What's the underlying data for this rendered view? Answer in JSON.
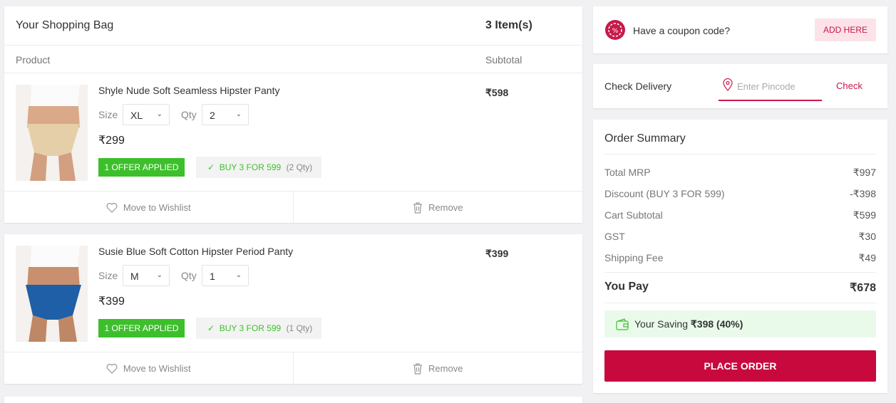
{
  "bag": {
    "title": "Your Shopping Bag",
    "count": "3 Item(s)",
    "col_product": "Product",
    "col_subtotal": "Subtotal"
  },
  "items": [
    {
      "name": "Shyle Nude Soft Seamless Hipster Panty",
      "subtotal": "₹598",
      "size_label": "Size",
      "size": "XL",
      "qty_label": "Qty",
      "qty": "2",
      "price": "₹299",
      "offer": "1 OFFER APPLIED",
      "promo": "BUY 3 FOR 599",
      "promo_qty": "(2 Qty)",
      "wishlist": "Move to Wishlist",
      "remove": "Remove",
      "color": "#e5cfa9"
    },
    {
      "name": "Susie Blue Soft Cotton Hipster Period Panty",
      "subtotal": "₹399",
      "size_label": "Size",
      "size": "M",
      "qty_label": "Qty",
      "qty": "1",
      "price": "₹399",
      "offer": "1 OFFER APPLIED",
      "promo": "BUY 3 FOR 599",
      "promo_qty": "(1 Qty)",
      "wishlist": "Move to Wishlist",
      "remove": "Remove",
      "color": "#1e5fa8"
    }
  ],
  "coupon": {
    "text": "Have a coupon code?",
    "button": "ADD HERE"
  },
  "delivery": {
    "label": "Check Delivery",
    "placeholder": "Enter Pincode",
    "button": "Check"
  },
  "summary": {
    "title": "Order Summary",
    "rows": [
      {
        "label": "Total MRP",
        "value": "₹997"
      },
      {
        "label": "Discount (BUY 3 FOR 599)",
        "value": "-₹398"
      },
      {
        "label": "Cart Subtotal",
        "value": "₹599"
      },
      {
        "label": "GST",
        "value": "₹30"
      },
      {
        "label": "Shipping Fee",
        "value": "₹49"
      }
    ],
    "pay_label": "You Pay",
    "pay_value": "₹678",
    "saving_prefix": "Your Saving",
    "saving_amount": "₹398",
    "saving_percent": "(40%)",
    "place_order": "PLACE ORDER"
  },
  "colors": {
    "accent": "#c8093e",
    "offer_green": "#3dbf2c"
  }
}
